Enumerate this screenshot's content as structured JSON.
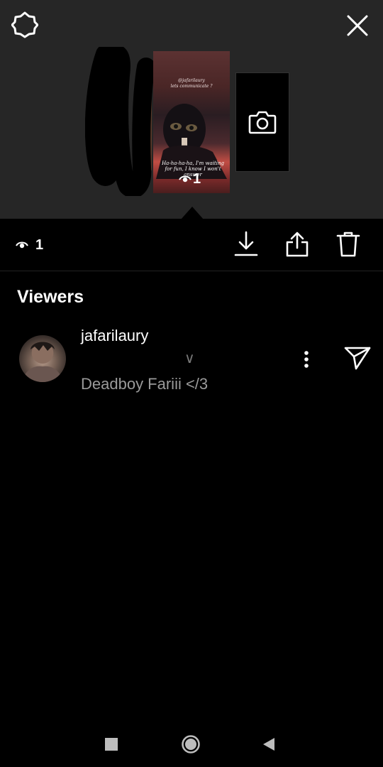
{
  "story_thumbnail": {
    "caption_top_line1": "@jafarilaury",
    "caption_top_line2": "lets communicate ?",
    "caption_bottom": "Ha-ha-ha-ha, I'm waiting for fun, I know I won't answer",
    "view_count": "1"
  },
  "actions": {
    "view_count": "1"
  },
  "viewers": {
    "heading": "Viewers",
    "items": [
      {
        "username": "jafarilaury",
        "mark": "∨",
        "full_name": "Deadboy Fariii </3"
      }
    ]
  },
  "icons": {
    "settings": "gear-icon",
    "close": "close-icon",
    "camera": "camera-icon",
    "eye": "eye-icon",
    "download": "download-icon",
    "share": "share-icon",
    "delete": "trash-icon",
    "more": "more-vertical-icon",
    "send": "send-icon",
    "nav_recent": "square-icon",
    "nav_home": "circle-icon",
    "nav_back": "triangle-back-icon"
  },
  "colors": {
    "top_panel_bg": "#262626",
    "page_bg": "#000000",
    "secondary_text": "#9a9a9a"
  }
}
